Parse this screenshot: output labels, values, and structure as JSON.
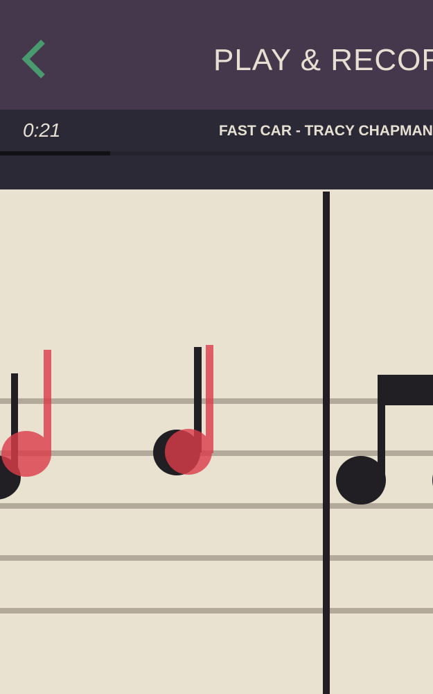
{
  "header": {
    "title": "PLAY & RECORD",
    "back_icon": "chevron-left-icon",
    "back_color": "#4a9a70"
  },
  "track": {
    "elapsed": "0:21",
    "song": "FAST CAR - TRACY CHAPMAN",
    "progress": 0.255
  },
  "colors": {
    "header_bg": "#46384c",
    "track_bg": "#2b2936",
    "paper": "#e9e2d1",
    "staff_line": "#b3aa9c",
    "note_black": "#221f24",
    "note_red": "#dc3c49"
  }
}
